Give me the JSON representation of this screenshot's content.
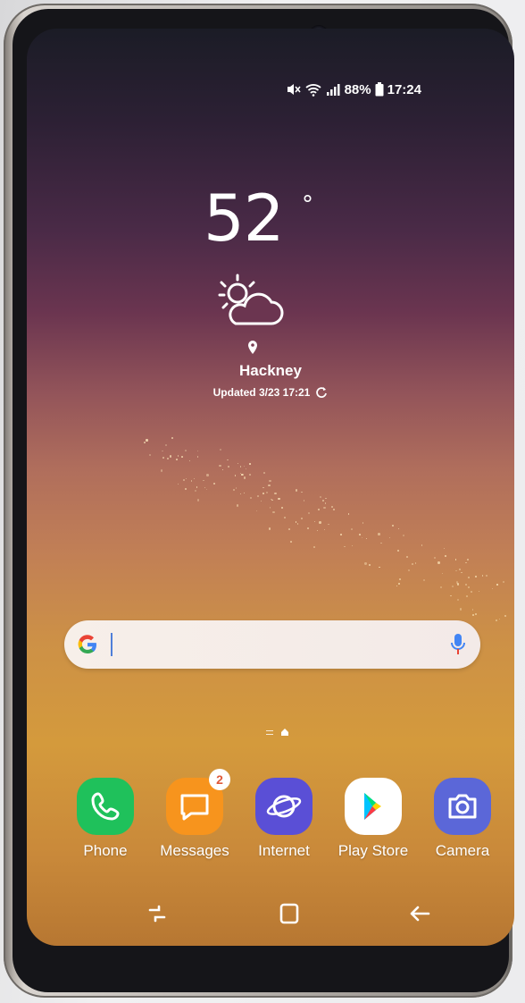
{
  "status_bar": {
    "battery": "88%",
    "time": "17:24",
    "icons": [
      "mute-icon",
      "wifi-icon",
      "signal-icon",
      "battery-icon"
    ]
  },
  "weather": {
    "temperature": "52",
    "degree_symbol": "°",
    "condition_icon": "partly-sunny-icon",
    "location": "Hackney",
    "updated": "Updated 3/23 17:21"
  },
  "search_bar": {
    "logo": "google-g-icon",
    "mic": "mic-icon"
  },
  "dock": {
    "apps": [
      {
        "label": "Phone",
        "icon": "phone-icon",
        "color": "#1fc15b"
      },
      {
        "label": "Messages",
        "icon": "messages-icon",
        "color": "#f7941d",
        "badge": "2"
      },
      {
        "label": "Internet",
        "icon": "internet-icon",
        "color": "#5a4fd6"
      },
      {
        "label": "Play Store",
        "icon": "play-store-icon",
        "color": "#ffffff"
      },
      {
        "label": "Camera",
        "icon": "camera-icon",
        "color": "#5b67d8"
      }
    ]
  },
  "nav_bar": {
    "buttons": [
      "recents-icon",
      "home-icon",
      "back-icon"
    ]
  }
}
